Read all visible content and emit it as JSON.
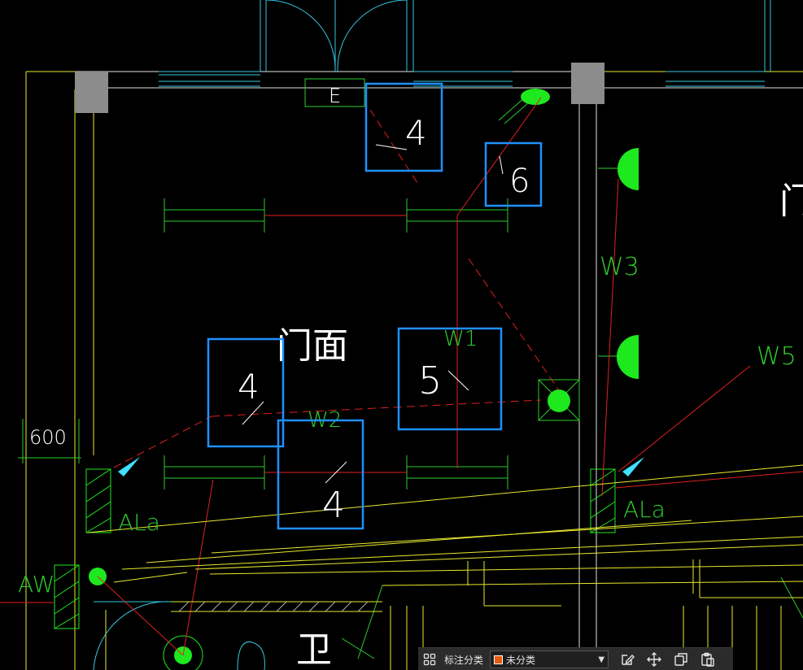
{
  "drawing": {
    "room_label": "门面",
    "dimension_label": "600",
    "wire_labels": {
      "w1": "W1",
      "w2": "W2",
      "w3": "W3",
      "w5": "W5"
    },
    "panel_labels": {
      "left": "ALa",
      "right": "ALa",
      "aw": "AW"
    },
    "outlet_label": "E",
    "side_glyph_right": "门",
    "bottom_glyph": "卫",
    "markups": [
      {
        "number": "4",
        "slash": "\\"
      },
      {
        "number": "6",
        "slash": "\\"
      },
      {
        "number": "4",
        "slash": "/"
      },
      {
        "number": "5",
        "slash": "\\"
      },
      {
        "number": "4",
        "slash": "/"
      }
    ]
  },
  "toolbar": {
    "grid_icon": "grid-icon",
    "category_label": "标注分类",
    "category_value": "未分类",
    "category_color": "#e85a0c",
    "actions": [
      "edit-icon",
      "move-icon",
      "copy-icon",
      "paste-icon"
    ]
  }
}
